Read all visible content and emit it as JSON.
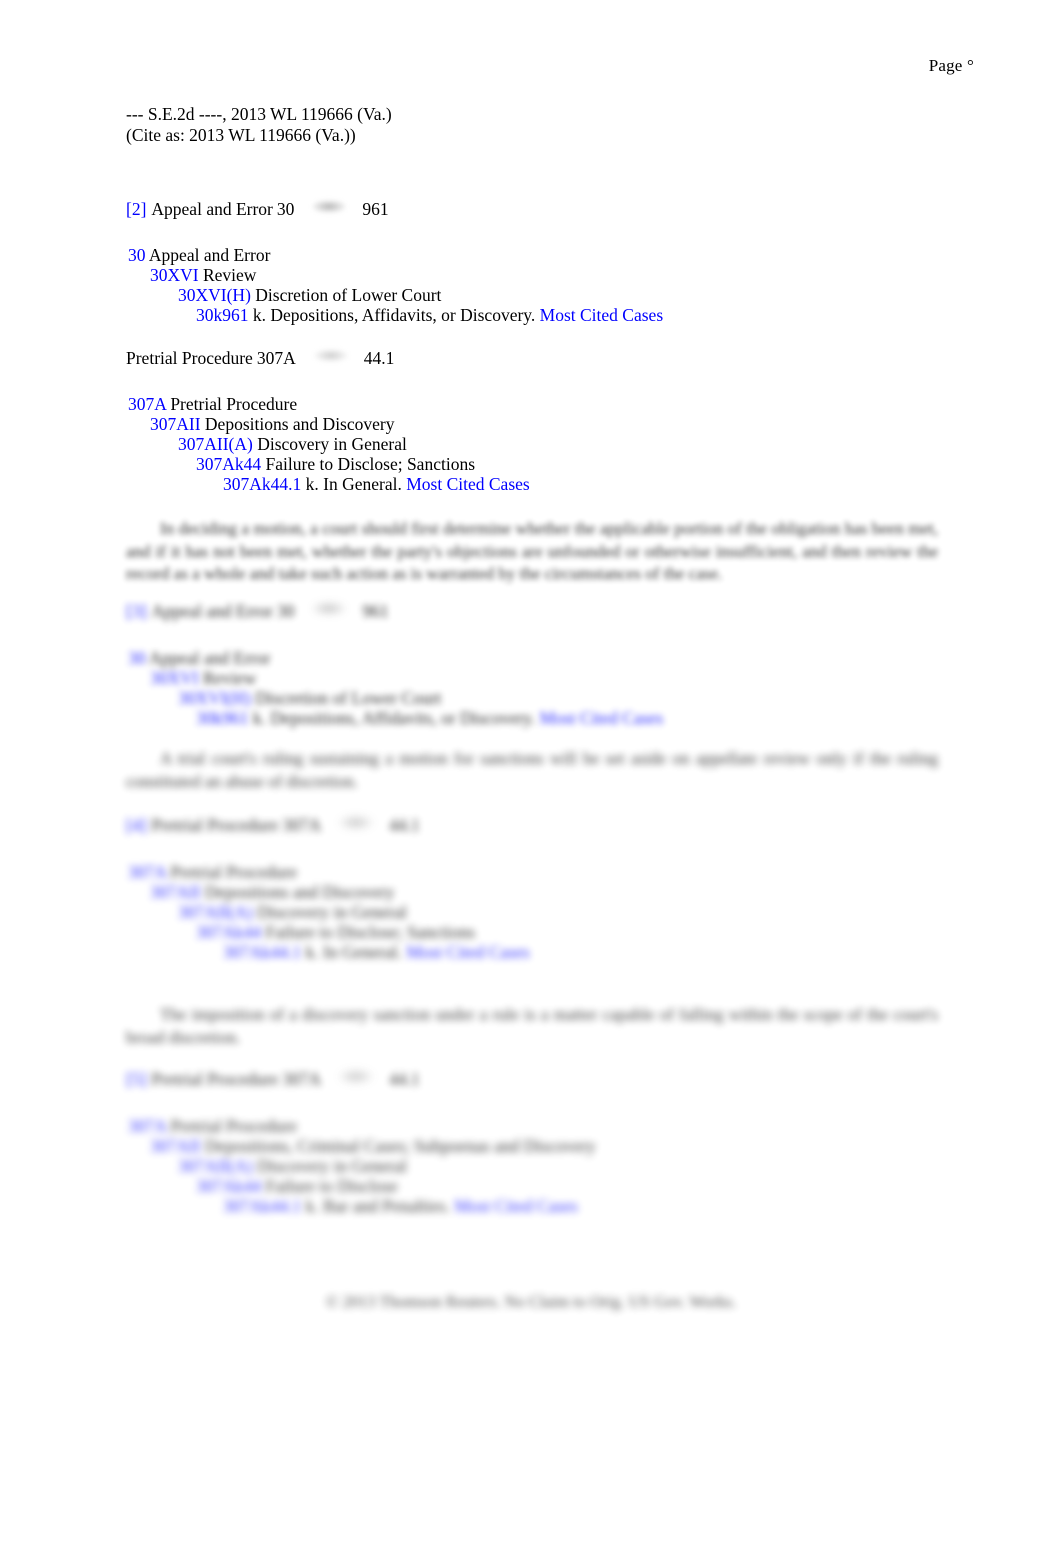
{
  "header": {
    "page_label": "Page °"
  },
  "citation": {
    "line1": "--- S.E.2d ----, 2013 WL 119666 (Va.)",
    "line2": "(Cite as: 2013 WL 119666 (Va.))"
  },
  "headnotes": [
    {
      "marker": "[2]",
      "topic": "Appeal and Error",
      "topic_number": "30",
      "key_icon": "west-key-icon",
      "key_number": "961",
      "outline": [
        {
          "code": "30",
          "label": "Appeal and Error",
          "level": 0
        },
        {
          "code": "30XVI",
          "label": "Review",
          "level": 1
        },
        {
          "code": "30XVI(H)",
          "label": "Discretion of Lower Court",
          "level": 2
        },
        {
          "code": "30k961",
          "label": "k. Depositions, Affidavits, or Discovery.",
          "level": 3,
          "most_cited": "Most Cited Cases"
        }
      ]
    },
    {
      "marker": "",
      "topic": "Pretrial Procedure",
      "topic_number": "307A",
      "key_icon": "west-key-icon",
      "key_number": "44.1",
      "outline": [
        {
          "code": "307A",
          "label": "Pretrial Procedure",
          "level": 0
        },
        {
          "code": "307AII",
          "label": "Depositions and Discovery",
          "level": 1
        },
        {
          "code": "307AII(A)",
          "label": "Discovery in General",
          "level": 2
        },
        {
          "code": "307Ak44",
          "label": "Failure to Disclose; Sanctions",
          "level": 3
        },
        {
          "code": "307Ak44.1",
          "label": "k. In General.",
          "level": 4,
          "most_cited": "Most Cited Cases"
        }
      ]
    },
    {
      "marker": "[3]",
      "topic": "Appeal and Error",
      "topic_number": "30",
      "key_icon": "west-key-icon",
      "key_number": "961",
      "obscured": true,
      "outline": [
        {
          "code": "30",
          "label": "Appeal and Error",
          "level": 0,
          "obscured": true
        },
        {
          "code": "30XVI",
          "label": "Review",
          "level": 1,
          "obscured": true
        },
        {
          "code": "30XVI(H)",
          "label": "Discretion of Lower Court",
          "level": 2,
          "obscured": true
        },
        {
          "code": "30k961",
          "label": "k. Depositions, Affidavits, or Discovery.",
          "level": 3,
          "most_cited": "Most Cited Cases",
          "obscured": true
        }
      ]
    },
    {
      "marker": "[4]",
      "topic": "Pretrial Procedure",
      "topic_number": "307A",
      "key_icon": "west-key-icon",
      "key_number": "44.1",
      "obscured": true,
      "outline": [
        {
          "code": "307A",
          "label": "Pretrial Procedure",
          "level": 0,
          "obscured": true
        },
        {
          "code": "307AII",
          "label": "Depositions and Discovery",
          "level": 1,
          "obscured": true
        },
        {
          "code": "307AII(A)",
          "label": "Discovery in General",
          "level": 2,
          "obscured": true
        },
        {
          "code": "307Ak44",
          "label": "Failure to Disclose; Sanctions",
          "level": 3,
          "obscured": true
        },
        {
          "code": "307Ak44.1",
          "label": "k. In General.",
          "level": 4,
          "most_cited": "Most Cited Cases",
          "obscured": true
        }
      ]
    },
    {
      "marker": "[5]",
      "topic": "Pretrial Procedure",
      "topic_number": "307A",
      "key_icon": "west-key-icon",
      "key_number": "44.1",
      "obscured": true,
      "outline": [
        {
          "code": "307A",
          "label": "Pretrial Procedure",
          "level": 0,
          "obscured": true
        },
        {
          "code": "307AII",
          "label": "Depositions, Criminal Cases; Subpoenas and Discovery",
          "level": 1,
          "obscured": true
        },
        {
          "code": "307AII(A)",
          "label": "Discovery in General",
          "level": 2,
          "obscured": true
        },
        {
          "code": "307Ak44",
          "label": "Failure to Disclose",
          "level": 3,
          "obscured": true
        },
        {
          "code": "307Ak44.1",
          "label": "k. Bar and Penalties.",
          "level": 4,
          "most_cited": "Most Cited Cases",
          "obscured": true
        }
      ]
    }
  ],
  "paragraphs": [
    {
      "id": "para-1",
      "obscured": true,
      "text": "In deciding a motion, a court should first determine whether the applicable portion of the obligation has been met, and if it has not been met, whether the party's objections are unfounded or otherwise insufficient, and then review the record as a whole and take such action as is warranted by the circumstances of the case."
    },
    {
      "id": "para-2",
      "obscured": true,
      "text": "A trial court's ruling sustaining a motion for sanctions will be set aside on appellate review only if the ruling constituted an abuse of discretion."
    },
    {
      "id": "para-3",
      "obscured": true,
      "text": "The imposition of a discovery sanction under a rule is a matter capable of falling within the scope of the court's broad discretion."
    }
  ],
  "footer": {
    "copyright": "© 2013 Thomson Reuters. No Claim to Orig. US Gov. Works."
  }
}
